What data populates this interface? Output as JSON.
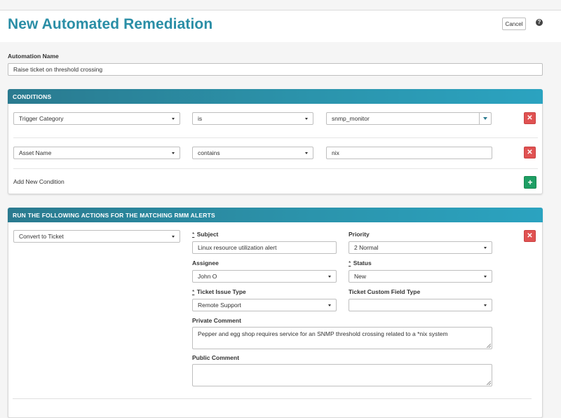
{
  "header": {
    "title": "New Automated Remediation",
    "cancel_label": "Cancel",
    "help_glyph": "?"
  },
  "automation_name": {
    "label": "Automation Name",
    "value": "Raise ticket on threshold crossing"
  },
  "conditions": {
    "title": "CONDITIONS",
    "rows": [
      {
        "field": "Trigger Category",
        "operator": "is",
        "value": "snmp_monitor"
      },
      {
        "field": "Asset Name",
        "operator": "contains",
        "value": "nix"
      }
    ],
    "add_label": "Add New Condition"
  },
  "actions": {
    "title": "RUN THE FOLLOWING ACTIONS FOR THE MATCHING RMM ALERTS",
    "action_type": "Convert to Ticket",
    "required_mark": "*",
    "subject": {
      "label": "Subject",
      "value": "Linux resource utilization alert"
    },
    "priority": {
      "label": "Priority",
      "value": "2 Normal"
    },
    "assignee": {
      "label": "Assignee",
      "value": "John O"
    },
    "status": {
      "label": "Status",
      "value": "New"
    },
    "ticket_issue_type": {
      "label": "Ticket Issue Type",
      "value": "Remote Support"
    },
    "ticket_custom_field_type": {
      "label": "Ticket Custom Field Type",
      "value": ""
    },
    "private_comment": {
      "label": "Private Comment",
      "value": "Pepper and egg shop requires service for an SNMP threshold crossing related to a *nix system"
    },
    "public_comment": {
      "label": "Public Comment",
      "value": ""
    }
  },
  "colors": {
    "title": "#2a8ea6",
    "panel_header": "#2b93ab",
    "remove": "#e05252",
    "add": "#1e9e64"
  },
  "icons": {
    "remove": "close-icon",
    "add": "plus-icon",
    "help": "help-icon",
    "dropdown": "chevron-down-icon"
  }
}
